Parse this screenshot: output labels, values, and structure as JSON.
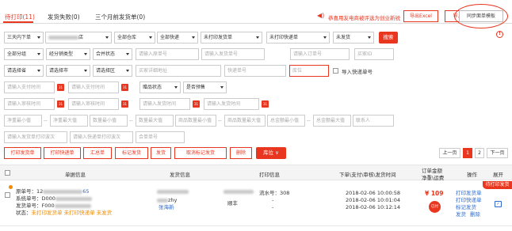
{
  "tabs": [
    {
      "label": "待打印(11)"
    },
    {
      "label": "发货失败(0)"
    },
    {
      "label": "三个月前发货单(0)"
    }
  ],
  "header": {
    "notice": "恭喜用友电商被评选为创业新锐",
    "notice_display": "恭喜用友电商被评选为创业新锐",
    "export_excel": "导出Excel",
    "import_tracking": "导入快递单号",
    "sync_template": "同步面单模板"
  },
  "filters": {
    "row1": {
      "date_range": "三天内下单",
      "shop_suffix": "店",
      "warehouse": "全部仓库",
      "courier": "全部快递",
      "ship_print": "未打印发货单",
      "express_print": "未打印快递单",
      "ship_status": "未发货",
      "search": "搜索"
    },
    "row2": {
      "group": "全部分组",
      "sales_type": "经分销类型",
      "merge_status": "合并状态",
      "order_no_placeholder": "请输入原单号",
      "ship_no_placeholder": "请输入发货单号",
      "order_input_placeholder": "请输入订单号",
      "buyer_id_placeholder": "买家ID"
    },
    "row3": {
      "province": "请选择省",
      "city": "请选择市",
      "district": "请选择区",
      "address_placeholder": "买家详细地址",
      "tracking_placeholder": "快递单号",
      "location_placeholder": "库位",
      "import_tracking_label": "导入快递单号"
    },
    "row4": {
      "pay_time_start": "请输入支付时间",
      "pay_time_end": "请输入支付时间",
      "gift_status": "赠品状态",
      "presale": "是否预售"
    },
    "row5": {
      "audit_start": "请输入审核时间",
      "audit_end": "请输入审核时间",
      "ship_start": "请输入发货时间",
      "ship_end": "请输入发货时间"
    },
    "row6": {
      "weight_min": "净重最小值",
      "weight_max": "净重最大值",
      "qty_min": "数量最小值",
      "qty_max": "数量最大值",
      "sku_min": "商品数量最小值",
      "sku_max": "商品数量最大值",
      "amount_min": "总金额最小值",
      "amount_max": "总金额最大值",
      "contact": "联系人"
    },
    "row7": {
      "ship_batch": "请输入发货单打印波次",
      "express_batch": "请输入快递单打印波次",
      "merge_no": "合单单号"
    }
  },
  "actions": {
    "print_ship": "打印发货单",
    "print_express": "打印快递单",
    "summary": "汇总单",
    "mark_ship": "标记发货",
    "ship": "发货",
    "cancel_mark": "取消标记发货",
    "delete": "删除",
    "location": "库位"
  },
  "pagination": {
    "prev": "上一页",
    "page1": "1",
    "page2": "2",
    "next": "下一页"
  },
  "table": {
    "headers": {
      "order_info": "单据信息",
      "ship_info": "发货信息",
      "print_info": "打印信息",
      "times": "下单\\支付\\审核\\发货时间",
      "amount1": "订单金额",
      "amount2": "净重\\运费",
      "ops": "操作",
      "expand": "展开"
    },
    "row": {
      "ribbon": "待打印发货",
      "orig_no_label": "原单号：12",
      "orig_no_tail": "65",
      "sys_no_label": "系统单号：D000",
      "ship_no_label": "发货单号：F000",
      "status_label": "状态：",
      "status_values": "未打印发货单 未打印快递单 未发货",
      "buyer_suffix": "zhy",
      "buyer_name": "张海新",
      "courier": "顺丰",
      "flow_no": "流水号：308",
      "t1": "2018-02-06 10:00:58",
      "t2": "2018-02-06 10:01:04",
      "t3": "2018-02-06 10:12:14",
      "dash1": "-",
      "dash2": "-",
      "price": "¥ 109",
      "badge": "已付",
      "op_print_ship": "打印发货单",
      "op_print_express": "打印快递单",
      "op_mark": "标记发货",
      "op_ship": "发货",
      "op_delete": "删除"
    }
  }
}
